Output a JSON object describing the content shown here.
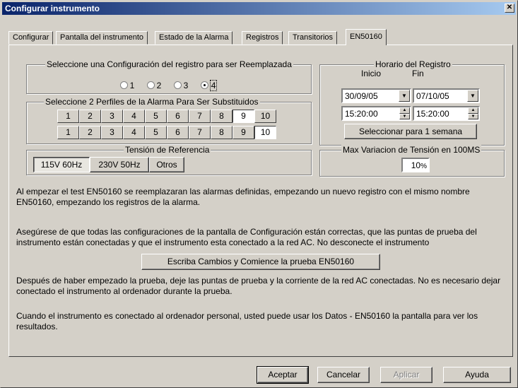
{
  "window": {
    "title": "Configurar instrumento",
    "close_glyph": "✕"
  },
  "tabs": [
    {
      "label": "Configurar"
    },
    {
      "label": "Pantalla del instrumento"
    },
    {
      "label": "Estado de la Alarma"
    },
    {
      "label": "Registros"
    },
    {
      "label": "Transitorios"
    },
    {
      "label": "EN50160",
      "active": true
    }
  ],
  "config_group": {
    "legend": "Seleccione una Configuración del registro para ser Reemplazada",
    "options": [
      "1",
      "2",
      "3",
      "4"
    ],
    "selected": "4"
  },
  "schedule_group": {
    "legend": "Horario del Registro",
    "start_label": "Inicio",
    "end_label": "Fin",
    "start_date": "30/09/05",
    "end_date": "07/10/05",
    "start_time": "15:20:00",
    "end_time": "15:20:00",
    "week_button": "Seleccionar para 1 semana"
  },
  "alarm_group": {
    "legend": "Seleccione 2 Perfiles de la Alarma Para Ser Substituidos",
    "row1": [
      "1",
      "2",
      "3",
      "4",
      "5",
      "6",
      "7",
      "8",
      "9",
      "10"
    ],
    "row1_selected": "9",
    "row2": [
      "1",
      "2",
      "3",
      "4",
      "5",
      "6",
      "7",
      "8",
      "9",
      "10"
    ],
    "row2_selected": "10"
  },
  "voltage_group": {
    "legend": "Tensión de Referencia",
    "options": [
      "115V 60Hz",
      "230V 50Hz",
      "Otros"
    ],
    "selected": "115V 60Hz"
  },
  "variation_group": {
    "legend": "Max Variacion de Tensión en 100MS",
    "value": "10",
    "unit": "%"
  },
  "texts": {
    "p1": "Al empezar el test EN50160 se reemplazaran las alarmas definidas, empezando un nuevo registro con el mismo nombre EN50160,  empezando los registros de la alarma.",
    "p2": "Asegúrese de que todas las configuraciones de la pantalla de Configuración están correctas, que las puntas de prueba del instrumento están conectadas y que el instrumento esta conectado a la red AC. No desconecte el instrumento",
    "start_button": "Escriba Cambios y Comience la prueba  EN50160",
    "p3": "Después de haber empezado la prueba, deje las puntas de prueba y la corriente de la red AC conectadas. No es necesario dejar conectado el instrumento al ordenador durante la prueba.",
    "p4": "Cuando el instrumento es conectado al ordenador personal, usted puede usar los Datos - EN50160 la pantalla para ver los resultados."
  },
  "footer": {
    "ok": "Aceptar",
    "cancel": "Cancelar",
    "apply": "Aplicar",
    "help": "Ayuda"
  }
}
